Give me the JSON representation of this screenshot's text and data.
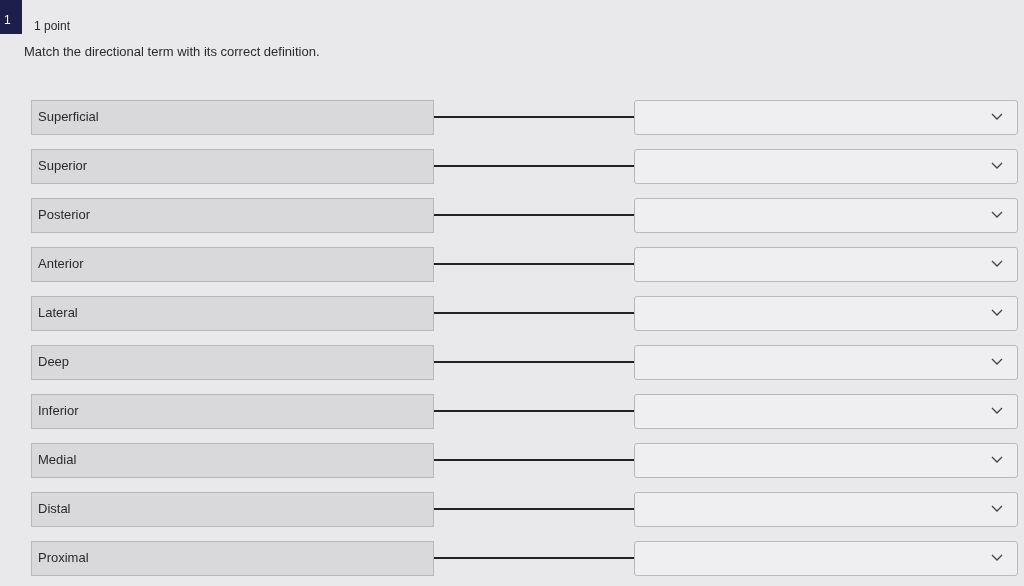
{
  "question": {
    "number": "1",
    "points": "1 point",
    "prompt": "Match the directional term with its correct definition."
  },
  "pairs": [
    {
      "term": "Superficial"
    },
    {
      "term": "Superior"
    },
    {
      "term": "Posterior"
    },
    {
      "term": "Anterior"
    },
    {
      "term": "Lateral"
    },
    {
      "term": "Deep"
    },
    {
      "term": "Inferior"
    },
    {
      "term": "Medial"
    },
    {
      "term": "Distal"
    },
    {
      "term": "Proximal"
    }
  ]
}
